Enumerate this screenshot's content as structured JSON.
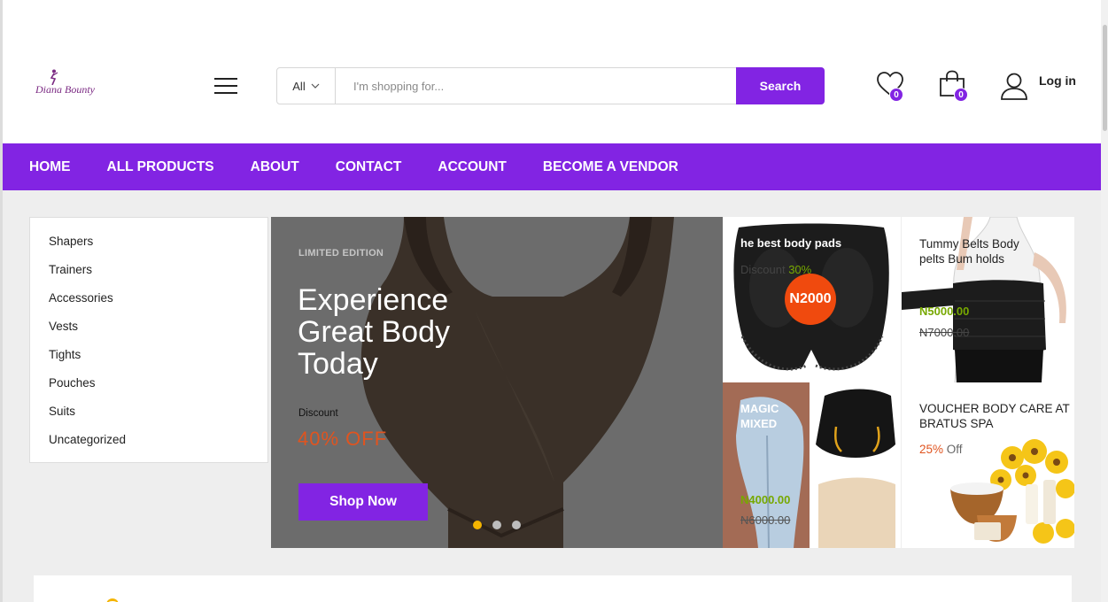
{
  "brand": {
    "logo_text": "Diana Bounty",
    "accent_color": "#8224e3"
  },
  "header": {
    "menu_icon": "hamburger-icon",
    "search": {
      "category": "All",
      "placeholder": "I'm shopping for...",
      "button_label": "Search"
    },
    "wishlist": {
      "icon": "heart-icon",
      "count": "0"
    },
    "cart": {
      "icon": "shopping-bag-icon",
      "count": "0"
    },
    "account": {
      "icon": "user-icon",
      "label": "Log in"
    }
  },
  "nav": {
    "items": [
      {
        "label": "HOME"
      },
      {
        "label": "ALL PRODUCTS"
      },
      {
        "label": "ABOUT"
      },
      {
        "label": "CONTACT"
      },
      {
        "label": "ACCOUNT"
      },
      {
        "label": "BECOME A VENDOR"
      }
    ]
  },
  "categories": [
    "Shapers",
    "Trainers",
    "Accessories",
    "Vests",
    "Tights",
    "Pouches",
    "Suits",
    "Uncategorized"
  ],
  "hero": {
    "tag": "LIMITED EDITION",
    "title": "Experience Great Body Today",
    "discount_label": "Discount",
    "discount_value": "40% OFF",
    "button_label": "Shop Now",
    "slides": 3,
    "active_slide": 1
  },
  "promos": {
    "body_pads": {
      "title": "he best body pads",
      "discount_label": "Discount",
      "discount_value": "30%",
      "price": "N2000"
    },
    "tummy_belts": {
      "title": "Tummy Belts Body pelts Bum holds",
      "new_price": "N5000.00",
      "old_price": "N7000.00"
    },
    "magic_mixed": {
      "title": "MAGIC MIXED",
      "new_price": "N4000.00",
      "old_price": "N6000.00"
    },
    "voucher": {
      "title": "VOUCHER BODY CARE AT BRATUS SPA",
      "discount_value": "25%",
      "discount_suffix": "Off"
    }
  }
}
